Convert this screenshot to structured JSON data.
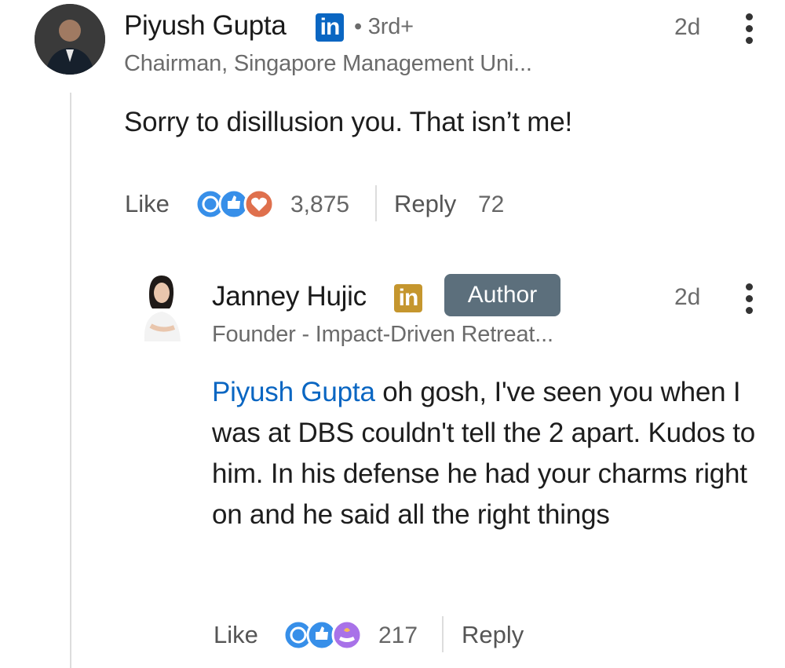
{
  "comment": {
    "author": "Piyush Gupta",
    "degree": "• 3rd+",
    "headline": "Chairman, Singapore Management Uni...",
    "time": "2d",
    "text": "Sorry to disillusion you. That isn’t me!",
    "like_label": "Like",
    "reaction_count": "3,875",
    "reply_label": "Reply",
    "reply_count": "72",
    "badge_text": "in",
    "badge_color": "#0a66c2"
  },
  "reply": {
    "author": "Janney Hujic",
    "author_badge": "Author",
    "headline": "Founder - Impact-Driven Retreat...",
    "time": "2d",
    "mention": "Piyush Gupta",
    "text": " oh gosh, I've seen you when I was at DBS couldn't tell the 2 apart. Kudos to him. In his defense he had your charms right on and he said all the right things",
    "like_label": "Like",
    "reaction_count": "217",
    "reply_label": "Reply",
    "badge_text": "in",
    "badge_color": "#c5962e"
  }
}
